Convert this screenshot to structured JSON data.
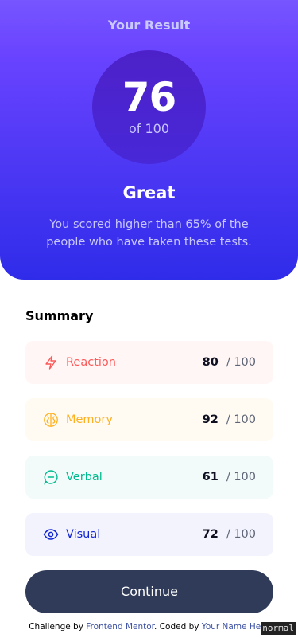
{
  "result": {
    "heading": "Your Result",
    "score": "76",
    "score_total": "of 100",
    "rating": "Great",
    "description": "You scored higher than 65% of the people who have taken these tests."
  },
  "summary": {
    "heading": "Summary",
    "items": [
      {
        "icon": "lightning-icon",
        "label": "Reaction",
        "score": "80",
        "max": "/ 100",
        "color": "#ff5757"
      },
      {
        "icon": "brain-icon",
        "label": "Memory",
        "score": "92",
        "max": "/ 100",
        "color": "#ffb01f"
      },
      {
        "icon": "chat-bubble-icon",
        "label": "Verbal",
        "score": "61",
        "max": "/ 100",
        "color": "#00bb8f"
      },
      {
        "icon": "eye-icon",
        "label": "Visual",
        "score": "72",
        "max": "/ 100",
        "color": "#1125d6"
      }
    ],
    "continue_label": "Continue"
  },
  "attribution": {
    "prefix": "Challenge by",
    "link1": "Frontend Mentor",
    "middle": ". Coded by",
    "link2": "Your Name Here"
  },
  "mode_badge": "normal"
}
